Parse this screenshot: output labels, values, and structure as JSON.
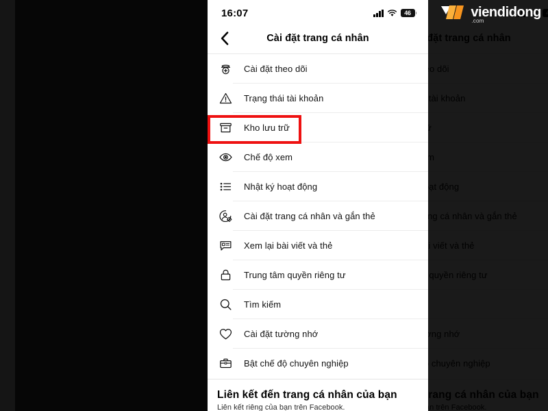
{
  "status_bar": {
    "time": "16:07",
    "signal_icon": "cellular-signal-icon",
    "wifi_icon": "wifi-icon",
    "battery_level": "46"
  },
  "nav": {
    "back_icon": "chevron-left-icon",
    "title": "Cài đặt trang cá nhân"
  },
  "menu": {
    "items": [
      {
        "label": "Cài đặt theo dõi",
        "icon": "follow-settings-icon"
      },
      {
        "label": "Trạng thái tài khoản",
        "icon": "warning-triangle-icon"
      },
      {
        "label": "Kho lưu trữ",
        "icon": "archive-box-icon",
        "highlighted": true
      },
      {
        "label": "Chế độ xem",
        "icon": "eye-icon"
      },
      {
        "label": "Nhật ký hoạt động",
        "icon": "activity-list-icon"
      },
      {
        "label": "Cài đặt trang cá nhân và gắn thẻ",
        "icon": "profile-tag-settings-icon"
      },
      {
        "label": "Xem lại bài viết và thẻ",
        "icon": "review-posts-icon"
      },
      {
        "label": "Trung tâm quyền riêng tư",
        "icon": "lock-icon"
      },
      {
        "label": "Tìm kiếm",
        "icon": "search-icon"
      },
      {
        "label": "Cài đặt tường nhớ",
        "icon": "heart-icon"
      },
      {
        "label": "Bật chế độ chuyên nghiệp",
        "icon": "briefcase-icon"
      }
    ]
  },
  "bottom_section": {
    "title": "Liên kết đến trang cá nhân của bạn",
    "subtitle": "Liên kết riêng của bạn trên Facebook."
  },
  "watermark": {
    "brand": "viendidong",
    "suffix": ".com",
    "logo_icon": "viendidong-logo-icon"
  },
  "colors": {
    "highlight": "#ee1111",
    "logo_orange_light": "#fbb03b",
    "logo_orange_dark": "#f7941e",
    "background": "#000000",
    "screen": "#ffffff"
  }
}
